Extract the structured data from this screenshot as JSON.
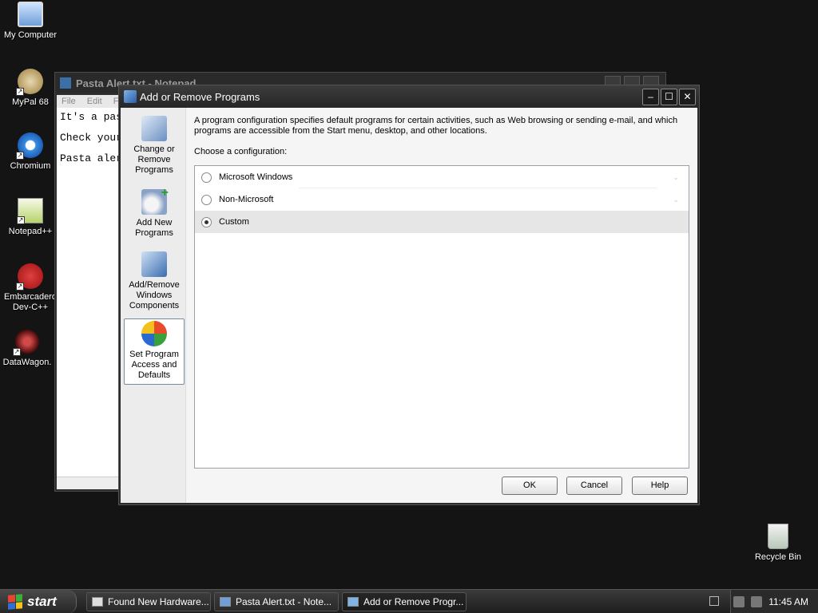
{
  "desktop": {
    "icons": [
      {
        "label": "My Computer"
      },
      {
        "label": "MyPal 68"
      },
      {
        "label": "Chromium"
      },
      {
        "label": "Notepad++"
      },
      {
        "label": "Embarcadero Dev-C++"
      },
      {
        "label": "DataWagon."
      },
      {
        "label": "Recycle Bin"
      }
    ]
  },
  "notepad": {
    "title": "Pasta Alert.txt - Notepad",
    "menu": [
      "File",
      "Edit",
      "Fo"
    ],
    "lines": [
      "It's a pas",
      "Check your",
      "Pasta aler"
    ]
  },
  "dialog": {
    "title": "Add or Remove Programs",
    "sidebar": [
      {
        "label": "Change or Remove Programs"
      },
      {
        "label": "Add New Programs"
      },
      {
        "label": "Add/Remove Windows Components"
      },
      {
        "label": "Set Program Access and Defaults"
      }
    ],
    "description": "A program configuration specifies default programs for certain activities, such as Web browsing or sending e-mail, and which programs are accessible from the Start menu, desktop, and other locations.",
    "choose_label": "Choose a configuration:",
    "options": [
      {
        "label": "Microsoft Windows",
        "selected": false
      },
      {
        "label": "Non-Microsoft",
        "selected": false
      },
      {
        "label": "Custom",
        "selected": true
      }
    ],
    "buttons": {
      "ok": "OK",
      "cancel": "Cancel",
      "help": "Help"
    }
  },
  "taskbar": {
    "start_label": "start",
    "tasks": [
      {
        "label": "Found New Hardware..."
      },
      {
        "label": "Pasta Alert.txt - Note..."
      },
      {
        "label": "Add or Remove Progr..."
      }
    ],
    "clock": "11:45 AM"
  },
  "colors": {
    "desktop_bg": "#141414",
    "dialog_frame": "#2b2b2b",
    "selected_row": "#e6e6e6"
  }
}
